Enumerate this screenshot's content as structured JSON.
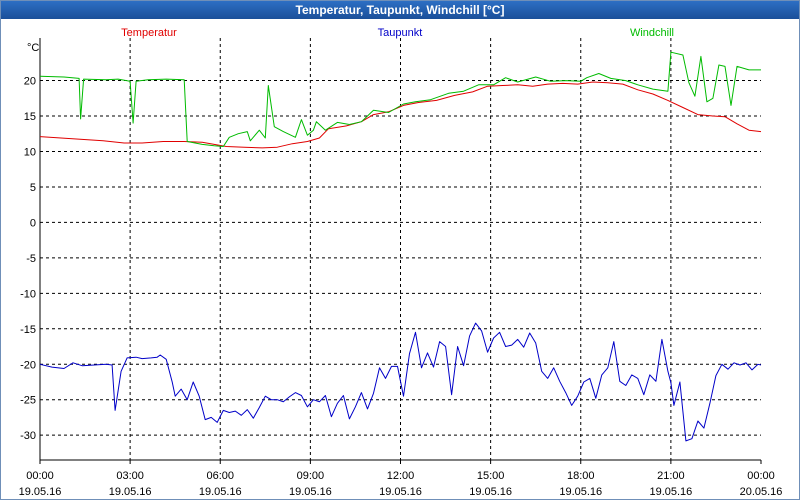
{
  "window": {
    "title": "Temperatur, Taupunkt, Windchill [°C]"
  },
  "chart_data": {
    "type": "line",
    "title": "Temperatur, Taupunkt, Windchill [°C]",
    "ylabel": "°C",
    "ylim": [
      -33.5,
      26
    ],
    "xlim": [
      0,
      24
    ],
    "yticks": [
      20,
      15,
      10,
      5,
      0,
      -5,
      -10,
      -15,
      -20,
      -25,
      -30
    ],
    "xticks": [
      {
        "time": "00:00",
        "date": "19.05.16",
        "h": 0
      },
      {
        "time": "03:00",
        "date": "19.05.16",
        "h": 3
      },
      {
        "time": "06:00",
        "date": "19.05.16",
        "h": 6
      },
      {
        "time": "09:00",
        "date": "19.05.16",
        "h": 9
      },
      {
        "time": "12:00",
        "date": "19.05.16",
        "h": 12
      },
      {
        "time": "15:00",
        "date": "19.05.16",
        "h": 15
      },
      {
        "time": "18:00",
        "date": "19.05.16",
        "h": 18
      },
      {
        "time": "21:00",
        "date": "19.05.16",
        "h": 21
      },
      {
        "time": "00:00",
        "date": "20.05.16",
        "h": 24
      }
    ],
    "grid": true,
    "legend_position": "top",
    "series": [
      {
        "name": "Temperatur",
        "color": "#e00000",
        "points": [
          [
            0,
            12.1
          ],
          [
            0.7,
            11.9
          ],
          [
            1.4,
            11.7
          ],
          [
            2.1,
            11.5
          ],
          [
            2.8,
            11.2
          ],
          [
            3.4,
            11.2
          ],
          [
            4.1,
            11.4
          ],
          [
            4.8,
            11.4
          ],
          [
            5.4,
            11.3
          ],
          [
            5.8,
            11.0
          ],
          [
            6.2,
            10.7
          ],
          [
            6.8,
            10.6
          ],
          [
            7.4,
            10.5
          ],
          [
            7.9,
            10.6
          ],
          [
            8.4,
            11.1
          ],
          [
            8.9,
            11.4
          ],
          [
            9.3,
            11.9
          ],
          [
            9.6,
            13.2
          ],
          [
            10.2,
            13.6
          ],
          [
            10.7,
            14.2
          ],
          [
            11.1,
            15.2
          ],
          [
            11.6,
            15.6
          ],
          [
            12.1,
            16.5
          ],
          [
            12.6,
            16.9
          ],
          [
            13.2,
            17.2
          ],
          [
            13.8,
            17.9
          ],
          [
            14.4,
            18.4
          ],
          [
            14.9,
            19.2
          ],
          [
            15.4,
            19.3
          ],
          [
            15.9,
            19.4
          ],
          [
            16.4,
            19.2
          ],
          [
            16.9,
            19.5
          ],
          [
            17.4,
            19.6
          ],
          [
            17.9,
            19.5
          ],
          [
            18.4,
            19.8
          ],
          [
            18.9,
            19.7
          ],
          [
            19.4,
            19.5
          ],
          [
            19.9,
            18.7
          ],
          [
            20.4,
            18.1
          ],
          [
            20.9,
            17.2
          ],
          [
            21.4,
            16.2
          ],
          [
            21.9,
            15.2
          ],
          [
            22.4,
            15.0
          ],
          [
            22.8,
            14.9
          ],
          [
            23.2,
            13.9
          ],
          [
            23.6,
            13.0
          ],
          [
            24,
            12.8
          ]
        ]
      },
      {
        "name": "Taupunkt",
        "color": "#0000c8",
        "points": [
          [
            0,
            -20.0
          ],
          [
            0.4,
            -20.4
          ],
          [
            0.8,
            -20.6
          ],
          [
            1.1,
            -19.8
          ],
          [
            1.4,
            -20.2
          ],
          [
            1.8,
            -20.1
          ],
          [
            2.2,
            -20.0
          ],
          [
            2.4,
            -20.1
          ],
          [
            2.5,
            -26.5
          ],
          [
            2.7,
            -21.0
          ],
          [
            2.9,
            -19.1
          ],
          [
            3.2,
            -19.0
          ],
          [
            3.4,
            -19.2
          ],
          [
            3.7,
            -19.1
          ],
          [
            3.9,
            -19.0
          ],
          [
            4.0,
            -18.7
          ],
          [
            4.2,
            -19.3
          ],
          [
            4.4,
            -22.5
          ],
          [
            4.5,
            -24.5
          ],
          [
            4.7,
            -23.5
          ],
          [
            4.9,
            -25.0
          ],
          [
            5.1,
            -22.5
          ],
          [
            5.3,
            -24.5
          ],
          [
            5.5,
            -27.8
          ],
          [
            5.7,
            -27.5
          ],
          [
            5.9,
            -28.2
          ],
          [
            6.1,
            -26.5
          ],
          [
            6.3,
            -26.8
          ],
          [
            6.5,
            -26.6
          ],
          [
            6.7,
            -27.2
          ],
          [
            6.9,
            -26.4
          ],
          [
            7.1,
            -27.6
          ],
          [
            7.3,
            -26.1
          ],
          [
            7.5,
            -24.5
          ],
          [
            7.7,
            -25.0
          ],
          [
            7.9,
            -25.0
          ],
          [
            8.1,
            -25.3
          ],
          [
            8.3,
            -24.6
          ],
          [
            8.5,
            -24.0
          ],
          [
            8.7,
            -24.4
          ],
          [
            8.9,
            -26.0
          ],
          [
            9.1,
            -25.0
          ],
          [
            9.3,
            -25.3
          ],
          [
            9.5,
            -24.4
          ],
          [
            9.7,
            -27.4
          ],
          [
            9.9,
            -25.5
          ],
          [
            10.1,
            -24.4
          ],
          [
            10.3,
            -27.7
          ],
          [
            10.5,
            -26.0
          ],
          [
            10.7,
            -24.0
          ],
          [
            10.9,
            -26.3
          ],
          [
            11.1,
            -24.1
          ],
          [
            11.3,
            -20.5
          ],
          [
            11.5,
            -22.0
          ],
          [
            11.7,
            -20.3
          ],
          [
            11.9,
            -20.3
          ],
          [
            12.1,
            -24.5
          ],
          [
            12.3,
            -18.5
          ],
          [
            12.5,
            -15.5
          ],
          [
            12.7,
            -20.5
          ],
          [
            12.9,
            -18.4
          ],
          [
            13.1,
            -20.4
          ],
          [
            13.3,
            -16.8
          ],
          [
            13.5,
            -17.5
          ],
          [
            13.7,
            -24.3
          ],
          [
            13.9,
            -17.5
          ],
          [
            14.1,
            -20.2
          ],
          [
            14.3,
            -16.0
          ],
          [
            14.5,
            -14.2
          ],
          [
            14.7,
            -15.3
          ],
          [
            14.9,
            -18.3
          ],
          [
            15.1,
            -16.3
          ],
          [
            15.3,
            -15.5
          ],
          [
            15.5,
            -17.5
          ],
          [
            15.7,
            -17.3
          ],
          [
            15.9,
            -16.5
          ],
          [
            16.1,
            -17.6
          ],
          [
            16.3,
            -15.6
          ],
          [
            16.5,
            -17.0
          ],
          [
            16.7,
            -21.0
          ],
          [
            16.9,
            -22.0
          ],
          [
            17.1,
            -20.5
          ],
          [
            17.3,
            -22.4
          ],
          [
            17.5,
            -24.0
          ],
          [
            17.7,
            -25.8
          ],
          [
            17.9,
            -24.5
          ],
          [
            18.1,
            -22.5
          ],
          [
            18.3,
            -22.0
          ],
          [
            18.5,
            -24.8
          ],
          [
            18.7,
            -21.5
          ],
          [
            18.9,
            -20.5
          ],
          [
            19.1,
            -16.8
          ],
          [
            19.3,
            -22.4
          ],
          [
            19.5,
            -23.0
          ],
          [
            19.7,
            -21.5
          ],
          [
            19.9,
            -22.0
          ],
          [
            20.1,
            -24.3
          ],
          [
            20.3,
            -21.5
          ],
          [
            20.5,
            -22.4
          ],
          [
            20.7,
            -16.5
          ],
          [
            20.9,
            -21.0
          ],
          [
            21.0,
            -22.6
          ],
          [
            21.1,
            -25.8
          ],
          [
            21.3,
            -22.5
          ],
          [
            21.5,
            -30.8
          ],
          [
            21.7,
            -30.5
          ],
          [
            21.9,
            -28.0
          ],
          [
            22.1,
            -29.0
          ],
          [
            22.3,
            -25.5
          ],
          [
            22.5,
            -21.6
          ],
          [
            22.7,
            -20.0
          ],
          [
            22.9,
            -20.7
          ],
          [
            23.1,
            -19.8
          ],
          [
            23.3,
            -20.1
          ],
          [
            23.5,
            -19.8
          ],
          [
            23.7,
            -20.8
          ],
          [
            23.9,
            -20.0
          ],
          [
            24,
            -20.1
          ]
        ]
      },
      {
        "name": "Windchill",
        "color": "#00bb00",
        "points": [
          [
            0,
            20.6
          ],
          [
            0.8,
            20.5
          ],
          [
            1.3,
            20.3
          ],
          [
            1.35,
            14.6
          ],
          [
            1.45,
            20.2
          ],
          [
            2.2,
            20.1
          ],
          [
            2.6,
            20.2
          ],
          [
            3.0,
            19.9
          ],
          [
            3.1,
            14.0
          ],
          [
            3.2,
            19.9
          ],
          [
            3.6,
            20.1
          ],
          [
            4.2,
            20.2
          ],
          [
            4.8,
            20.1
          ],
          [
            4.9,
            11.4
          ],
          [
            5.4,
            11.0
          ],
          [
            5.8,
            10.8
          ],
          [
            6.1,
            10.7
          ],
          [
            6.3,
            12.0
          ],
          [
            6.6,
            12.5
          ],
          [
            6.9,
            12.8
          ],
          [
            7.0,
            11.5
          ],
          [
            7.3,
            13.0
          ],
          [
            7.5,
            11.9
          ],
          [
            7.6,
            19.3
          ],
          [
            7.8,
            13.5
          ],
          [
            8.1,
            12.8
          ],
          [
            8.5,
            12.0
          ],
          [
            8.7,
            14.5
          ],
          [
            8.9,
            12.3
          ],
          [
            9.1,
            13.0
          ],
          [
            9.2,
            14.2
          ],
          [
            9.5,
            13.0
          ],
          [
            9.9,
            14.1
          ],
          [
            10.3,
            13.8
          ],
          [
            10.7,
            14.2
          ],
          [
            11.1,
            15.8
          ],
          [
            11.6,
            15.5
          ],
          [
            12.1,
            16.7
          ],
          [
            12.5,
            17.0
          ],
          [
            13.0,
            17.3
          ],
          [
            13.6,
            18.2
          ],
          [
            14.1,
            18.5
          ],
          [
            14.6,
            19.4
          ],
          [
            15.1,
            19.4
          ],
          [
            15.5,
            20.4
          ],
          [
            15.9,
            19.8
          ],
          [
            16.5,
            20.5
          ],
          [
            17.0,
            19.9
          ],
          [
            17.5,
            20.0
          ],
          [
            18.0,
            19.9
          ],
          [
            18.2,
            20.4
          ],
          [
            18.6,
            21.0
          ],
          [
            19.0,
            20.3
          ],
          [
            19.5,
            20.0
          ],
          [
            19.9,
            19.4
          ],
          [
            20.4,
            18.8
          ],
          [
            20.9,
            18.5
          ],
          [
            21.0,
            24.0
          ],
          [
            21.4,
            23.6
          ],
          [
            21.6,
            19.7
          ],
          [
            21.8,
            17.8
          ],
          [
            22.0,
            23.4
          ],
          [
            22.2,
            17.0
          ],
          [
            22.4,
            17.5
          ],
          [
            22.6,
            22.2
          ],
          [
            22.8,
            22.0
          ],
          [
            23.0,
            16.5
          ],
          [
            23.2,
            22.0
          ],
          [
            23.6,
            21.5
          ],
          [
            24,
            21.5
          ]
        ]
      }
    ]
  }
}
